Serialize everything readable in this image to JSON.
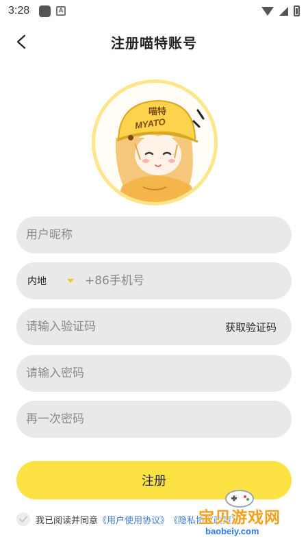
{
  "status_bar": {
    "time": "3:28"
  },
  "header": {
    "title": "注册喵特账号"
  },
  "form": {
    "nickname_placeholder": "用户昵称",
    "region_value": "内地",
    "phone_placeholder": "+86手机号",
    "code_placeholder": "请输入验证码",
    "get_code_label": "获取验证码",
    "password_placeholder": "请输入密码",
    "password_confirm_placeholder": "再一次密码",
    "register_label": "注册"
  },
  "agreement": {
    "prefix": "我已阅读并同意",
    "user_agreement_link": "《用户使用协议》",
    "privacy_link": "《隐私协议政策》"
  },
  "avatar": {
    "helmet_text_top": "喵特",
    "helmet_text_bottom": "MYATO"
  },
  "watermark": {
    "title": "宝贝游戏网",
    "url": "baobeiy.com"
  },
  "colors": {
    "accent": "#fde243",
    "field_bg": "#e9e9e9",
    "link": "#3a7bd5",
    "avatar_ring": "#fde68a"
  }
}
